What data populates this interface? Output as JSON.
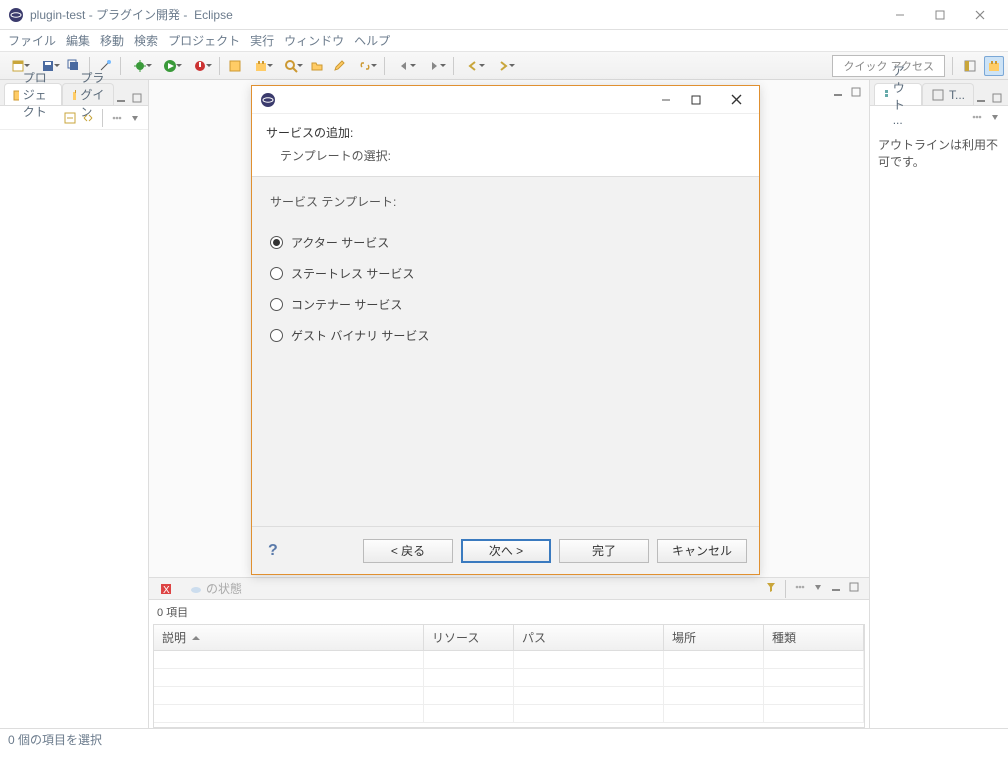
{
  "titlebar": {
    "project": "plugin-test",
    "perspective": "プラグイン開発",
    "app": "Eclipse"
  },
  "menubar": [
    "ファイル",
    "編集",
    "移動",
    "検索",
    "プロジェクト",
    "実行",
    "ウィンドウ",
    "ヘルプ"
  ],
  "toolbar": {
    "quick_access": "クイック アクセス"
  },
  "left": {
    "tab_project": "プロジェクト",
    "tab_plugin": "プラグイン"
  },
  "right": {
    "tab_outline": "アウト ...",
    "tab_task": "T...",
    "outline_empty": "アウトラインは利用不可です。"
  },
  "problems": {
    "status_tab": "の状態",
    "item_count": "0 項目",
    "columns": {
      "desc": "説明",
      "resource": "リソース",
      "path": "パス",
      "location": "場所",
      "type": "種類"
    }
  },
  "statusbar": {
    "text": "0 個の項目を選択"
  },
  "dialog": {
    "header_title": "サービスの追加:",
    "header_subtitle": "テンプレートの選択:",
    "legend": "サービス テンプレート:",
    "options": {
      "actor": "アクター サービス",
      "stateless": "ステートレス サービス",
      "container": "コンテナー サービス",
      "guest": "ゲスト バイナリ サービス"
    },
    "buttons": {
      "back": "< 戻る",
      "next": "次へ  >",
      "finish": "完了",
      "cancel": "キャンセル"
    }
  }
}
